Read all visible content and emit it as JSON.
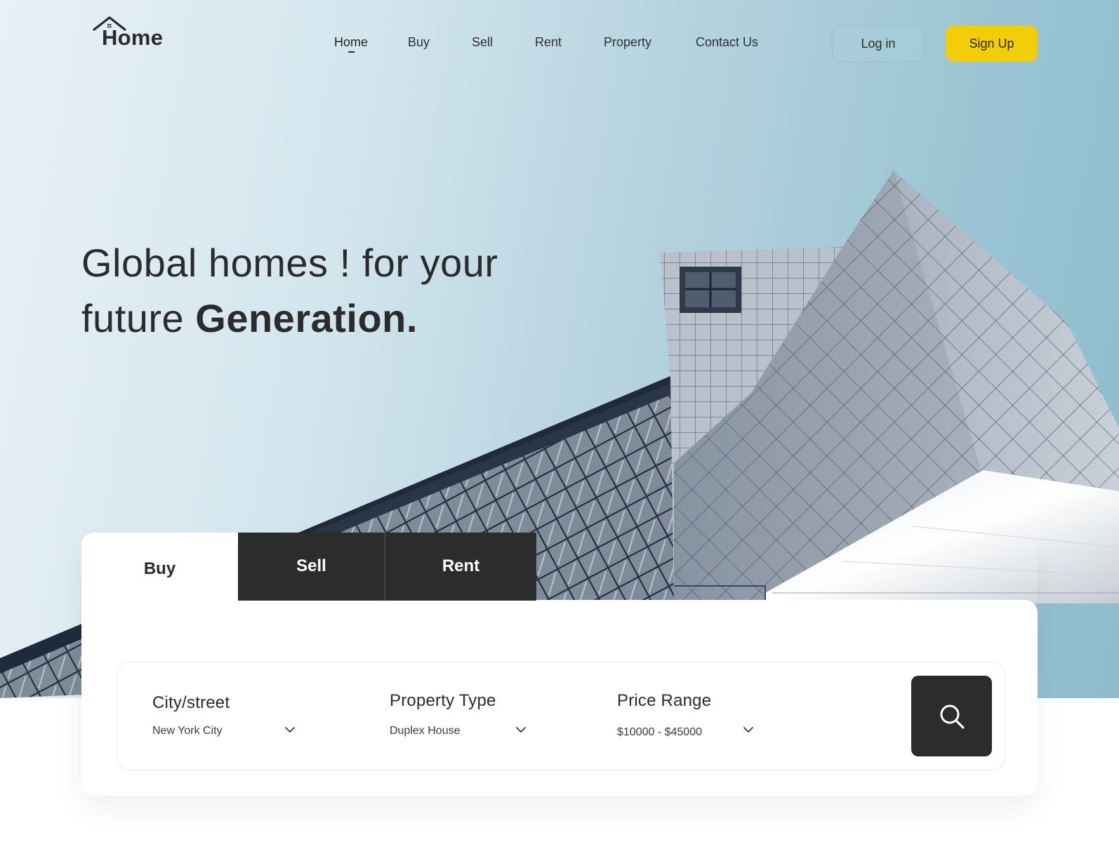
{
  "brand": {
    "name": "Home"
  },
  "nav": {
    "items": [
      {
        "label": "Home",
        "active": true
      },
      {
        "label": "Buy"
      },
      {
        "label": "Sell"
      },
      {
        "label": "Rent"
      },
      {
        "label": "Property"
      },
      {
        "label": "Contact Us"
      }
    ]
  },
  "auth": {
    "login_label": "Log in",
    "signup_label": "Sign Up"
  },
  "hero": {
    "headline_line1": "Global homes ! for your",
    "headline_line2_light": "future ",
    "headline_line2_bold": "Generation."
  },
  "search": {
    "tabs": [
      {
        "label": "Buy",
        "active": true
      },
      {
        "label": "Sell"
      },
      {
        "label": "Rent"
      }
    ],
    "fields": [
      {
        "label": "City/street",
        "value": "New York City"
      },
      {
        "label": "Property Type",
        "value": "Duplex House"
      },
      {
        "label": "Price Range",
        "value": "$10000 - $45000"
      }
    ],
    "search_icon": "search-icon"
  },
  "colors": {
    "accent": "#f3cd08",
    "dark": "#2b2c2c",
    "text": "#2b2b2b",
    "sky_light": "#e8f1f5",
    "sky_dark": "#8dbccc"
  }
}
